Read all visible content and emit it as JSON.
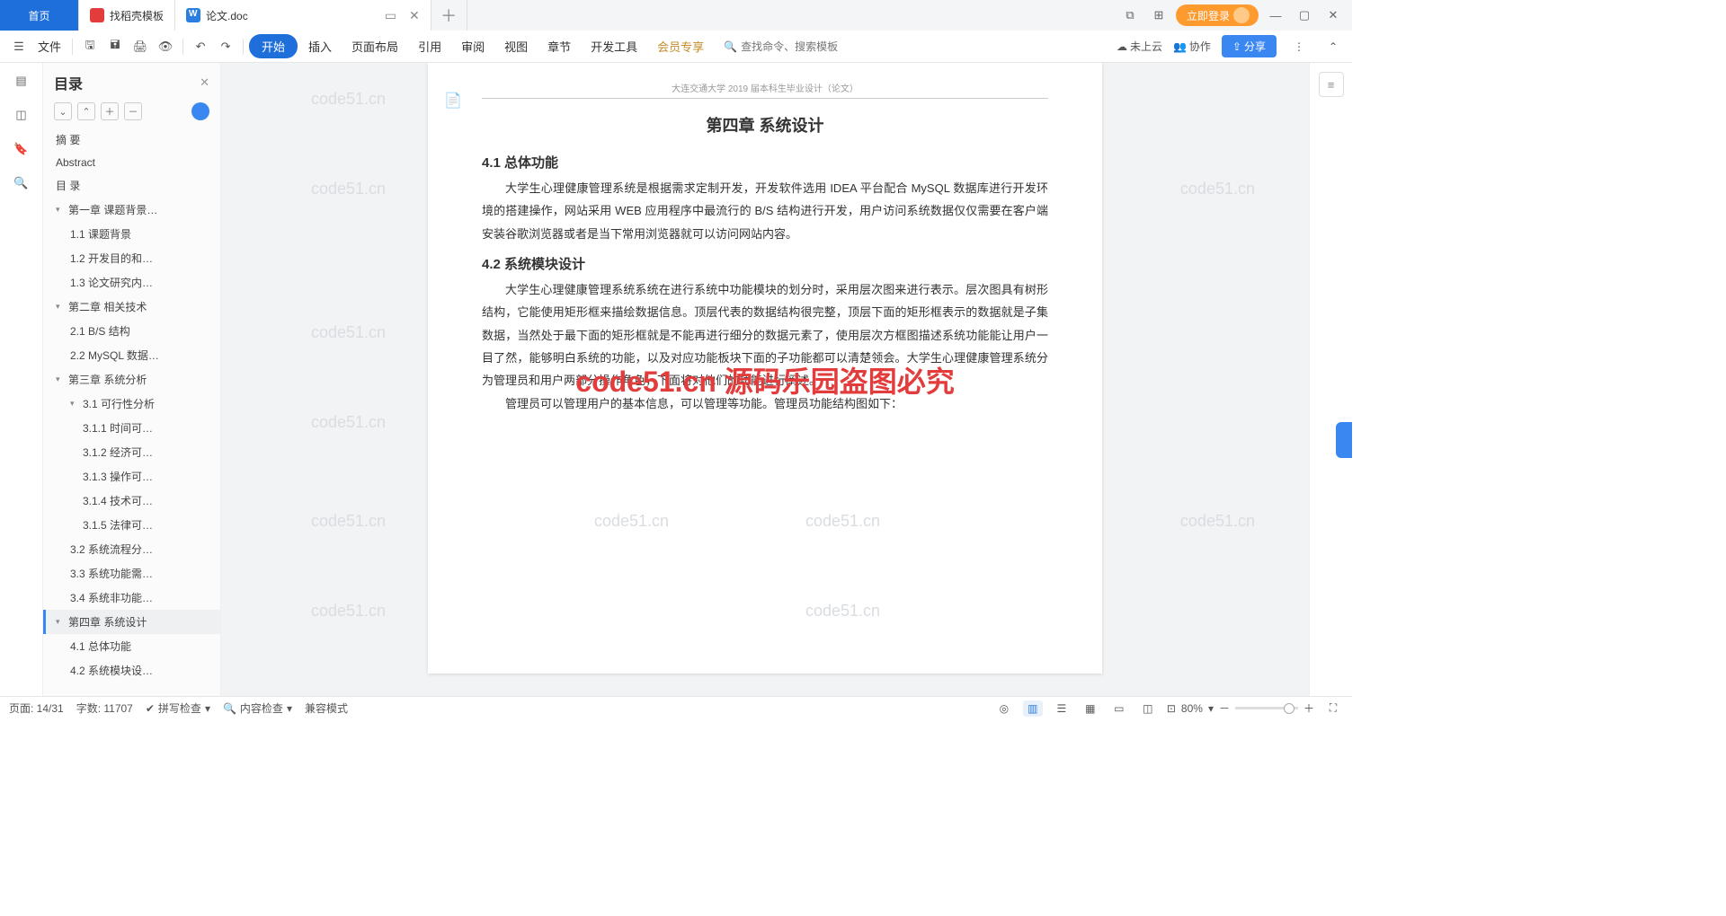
{
  "tabs": {
    "home": "首页",
    "template": "找稻壳模板",
    "doc": "论文.doc"
  },
  "win": {
    "login": "立即登录"
  },
  "menu": {
    "file": "文件",
    "items": [
      "开始",
      "插入",
      "页面布局",
      "引用",
      "审阅",
      "视图",
      "章节",
      "开发工具",
      "会员专享"
    ],
    "search_ph": "查找命令、搜索模板",
    "cloud": "未上云",
    "collab": "协作",
    "share": "分享"
  },
  "outline": {
    "title": "目录",
    "items": [
      {
        "l": 1,
        "t": "摘    要"
      },
      {
        "l": 1,
        "t": "Abstract"
      },
      {
        "l": 1,
        "t": "目    录"
      },
      {
        "l": 1,
        "t": "第一章  课题背景…",
        "c": true
      },
      {
        "l": 2,
        "t": "1.1 课题背景"
      },
      {
        "l": 2,
        "t": "1.2 开发目的和…"
      },
      {
        "l": 2,
        "t": "1.3 论文研究内…"
      },
      {
        "l": 1,
        "t": "第二章  相关技术",
        "c": true
      },
      {
        "l": 2,
        "t": "2.1 B/S 结构"
      },
      {
        "l": 2,
        "t": "2.2 MySQL 数据…"
      },
      {
        "l": 1,
        "t": "第三章  系统分析",
        "c": true
      },
      {
        "l": 2,
        "t": "3.1 可行性分析",
        "c": true
      },
      {
        "l": 3,
        "t": "3.1.1 时间可…"
      },
      {
        "l": 3,
        "t": "3.1.2 经济可…"
      },
      {
        "l": 3,
        "t": "3.1.3 操作可…"
      },
      {
        "l": 3,
        "t": "3.1.4 技术可…"
      },
      {
        "l": 3,
        "t": "3.1.5 法律可…"
      },
      {
        "l": 2,
        "t": "3.2 系统流程分…"
      },
      {
        "l": 2,
        "t": "3.3 系统功能需…"
      },
      {
        "l": 2,
        "t": "3.4 系统非功能…"
      },
      {
        "l": 1,
        "t": "第四章  系统设计",
        "c": true,
        "sel": true
      },
      {
        "l": 2,
        "t": "4.1 总体功能"
      },
      {
        "l": 2,
        "t": "4.2 系统模块设…"
      }
    ]
  },
  "doc": {
    "header": "大连交通大学 2019 届本科生毕业设计（论文）",
    "chapter": "第四章  系统设计",
    "s41": "4.1  总体功能",
    "p41": "大学生心理健康管理系统是根据需求定制开发，开发软件选用 IDEA 平台配合 MySQL 数据库进行开发环境的搭建操作，网站采用 WEB 应用程序中最流行的 B/S 结构进行开发，用户访问系统数据仅仅需要在客户端安装谷歌浏览器或者是当下常用浏览器就可以访问网站内容。",
    "s42": "4.2  系统模块设计",
    "p42a": "大学生心理健康管理系统系统在进行系统中功能模块的划分时，采用层次图来进行表示。层次图具有树形结构，它能使用矩形框来描绘数据信息。顶层代表的数据结构很完整，顶层下面的矩形框表示的数据就是子集数据，当然处于最下面的矩形框就是不能再进行细分的数据元素了，使用层次方框图描述系统功能能让用户一目了然，能够明白系统的功能，以及对应功能板块下面的子功能都可以清楚领会。大学生心理健康管理系统分为管理员和用户两部分操作角色，下面将对他们的功能进行阐述。",
    "p42b": "管理员可以管理用户的基本信息，可以管理等功能。管理员功能结构图如下：",
    "wm_red": "code51.cn 源码乐园盗图必究",
    "wm": "code51.cn"
  },
  "status": {
    "page": "页面: 14/31",
    "words": "字数: 11707",
    "spell": "拼写检查",
    "review": "内容检查",
    "compat": "兼容模式",
    "zoom": "80%"
  }
}
